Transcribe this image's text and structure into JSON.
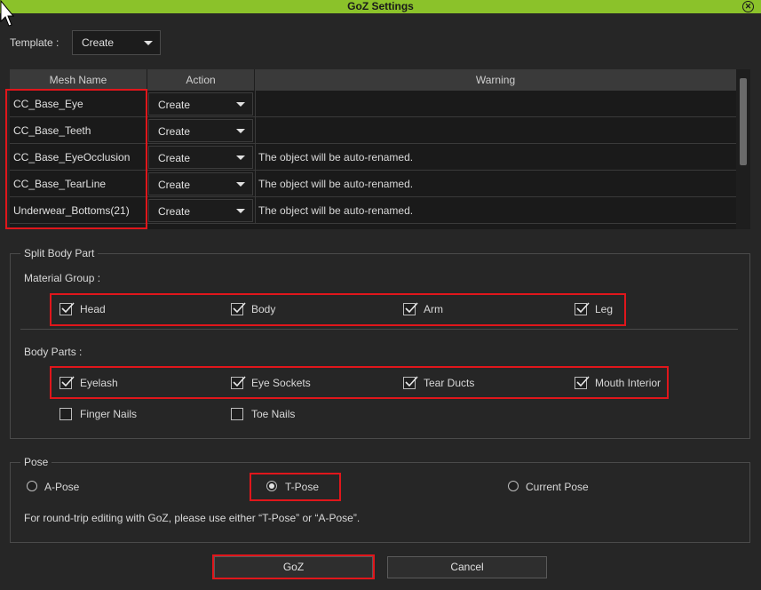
{
  "window": {
    "title": "GoZ Settings"
  },
  "template": {
    "label": "Template :",
    "value": "Create"
  },
  "table": {
    "headers": [
      "Mesh Name",
      "Action",
      "Warning"
    ],
    "rows": [
      {
        "mesh": "CC_Base_Eye",
        "action": "Create",
        "warning": ""
      },
      {
        "mesh": "CC_Base_Teeth",
        "action": "Create",
        "warning": ""
      },
      {
        "mesh": "CC_Base_EyeOcclusion",
        "action": "Create",
        "warning": "The object will be auto-renamed."
      },
      {
        "mesh": "CC_Base_TearLine",
        "action": "Create",
        "warning": "The object will be auto-renamed."
      },
      {
        "mesh": "Underwear_Bottoms(21)",
        "action": "Create",
        "warning": "The object will be auto-renamed."
      }
    ]
  },
  "split_body_part": {
    "title": "Split Body Part",
    "material_group_label": "Material Group :",
    "material_group": [
      {
        "label": "Head",
        "checked": true
      },
      {
        "label": "Body",
        "checked": true
      },
      {
        "label": "Arm",
        "checked": true
      },
      {
        "label": "Leg",
        "checked": true
      }
    ],
    "body_parts_label": "Body Parts :",
    "body_parts": [
      {
        "label": "Eyelash",
        "checked": true
      },
      {
        "label": "Eye Sockets",
        "checked": true
      },
      {
        "label": "Tear Ducts",
        "checked": true
      },
      {
        "label": "Mouth Interior",
        "checked": true
      },
      {
        "label": "Finger Nails",
        "checked": false
      },
      {
        "label": "Toe Nails",
        "checked": false
      }
    ]
  },
  "pose": {
    "title": "Pose",
    "options": [
      {
        "label": "A-Pose",
        "selected": false
      },
      {
        "label": "T-Pose",
        "selected": true
      },
      {
        "label": "Current Pose",
        "selected": false
      }
    ],
    "note": "For round-trip editing with GoZ, please use either “T-Pose” or “A-Pose”."
  },
  "buttons": {
    "goz": "GoZ",
    "cancel": "Cancel"
  },
  "colors": {
    "titlebar": "#8bc22a",
    "highlight": "#e0161b"
  }
}
